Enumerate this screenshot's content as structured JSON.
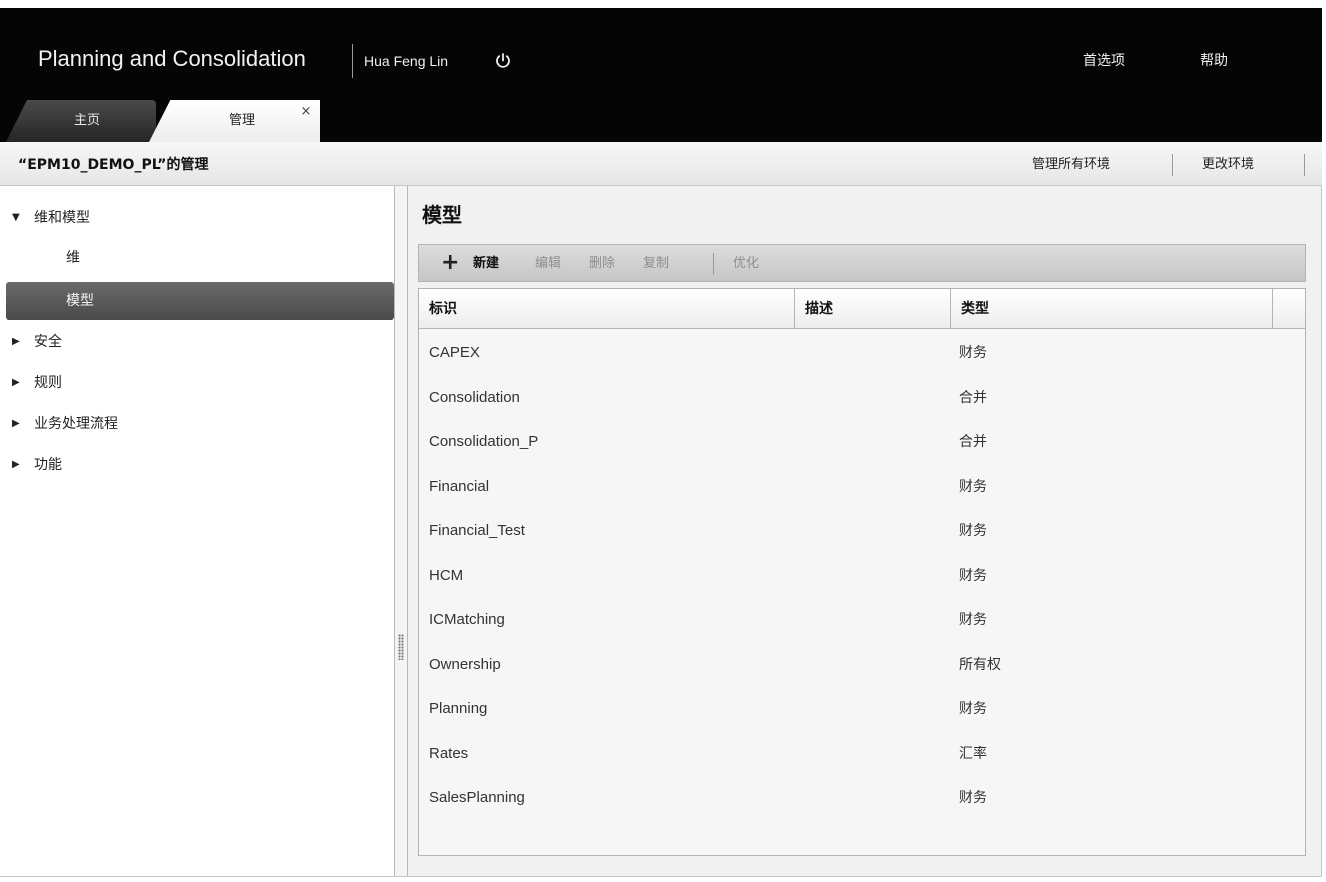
{
  "header": {
    "app_title": "Planning and Consolidation",
    "user_name": "Hua Feng Lin",
    "preferences_label": "首选项",
    "help_label": "帮助"
  },
  "tabs": [
    {
      "label": "主页",
      "active": false
    },
    {
      "label": "管理",
      "active": true
    }
  ],
  "tab_close_glyph": "×",
  "subheader": {
    "title": "“EPM10_DEMO_PL”的管理",
    "manage_all_label": "管理所有环境",
    "change_env_label": "更改环境"
  },
  "nav": {
    "items": [
      {
        "label": "维和模型",
        "expanded": true,
        "arrow": "▼"
      },
      {
        "label": "维",
        "sub": true
      },
      {
        "label": "模型",
        "sub": true,
        "selected": true
      },
      {
        "label": "安全",
        "expanded": false,
        "arrow": "▶"
      },
      {
        "label": "规则",
        "expanded": false,
        "arrow": "▶"
      },
      {
        "label": "业务处理流程",
        "expanded": false,
        "arrow": "▶"
      },
      {
        "label": "功能",
        "expanded": false,
        "arrow": "▶"
      }
    ]
  },
  "main": {
    "title": "模型",
    "toolbar": {
      "add_glyph": "+",
      "new_label": "新建",
      "edit_label": "编辑",
      "delete_label": "删除",
      "copy_label": "复制",
      "optimize_label": "优化"
    },
    "table": {
      "columns": [
        "标识",
        "描述",
        "类型"
      ],
      "rows": [
        {
          "id": "CAPEX",
          "description": "",
          "type": "财务"
        },
        {
          "id": "Consolidation",
          "description": "",
          "type": "合并"
        },
        {
          "id": "Consolidation_P",
          "description": "",
          "type": "合并"
        },
        {
          "id": "Financial",
          "description": "",
          "type": "财务"
        },
        {
          "id": "Financial_Test",
          "description": "",
          "type": "财务"
        },
        {
          "id": "HCM",
          "description": "",
          "type": "财务"
        },
        {
          "id": "ICMatching",
          "description": "",
          "type": "财务"
        },
        {
          "id": "Ownership",
          "description": "",
          "type": "所有权"
        },
        {
          "id": "Planning",
          "description": "",
          "type": "财务"
        },
        {
          "id": "Rates",
          "description": "",
          "type": "汇率"
        },
        {
          "id": "SalesPlanning",
          "description": "",
          "type": "财务"
        }
      ]
    }
  },
  "colors": {
    "header_bg": "#050505",
    "selected_nav_bg": "#555555",
    "disabled_text": "#8e8e8e"
  }
}
